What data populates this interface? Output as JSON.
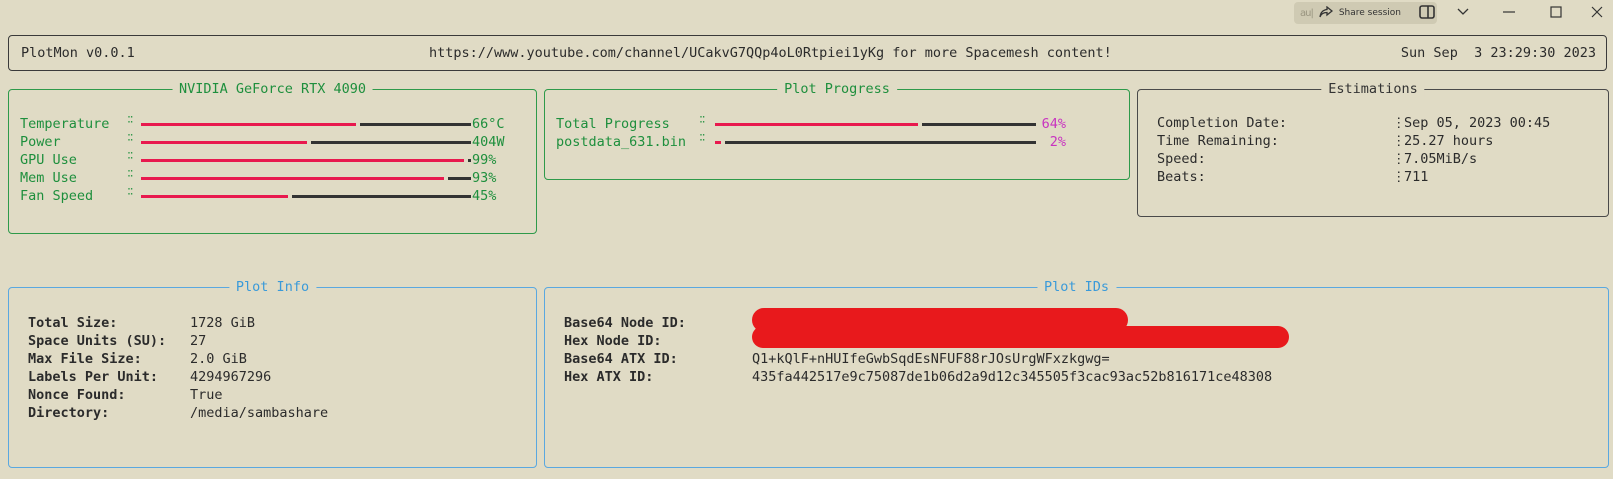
{
  "chrome": {
    "share_label": "Share session",
    "kbd_hint": "au|"
  },
  "header": {
    "app": "PlotMon v0.0.1",
    "message": "https://www.youtube.com/channel/UCakvG7QQp4oL0Rtpiei1yKg for more Spacemesh content!",
    "datetime": "Sun Sep  3 23:29:30 2023"
  },
  "gpu": {
    "title": "NVIDIA GeForce RTX 4090",
    "rows": [
      {
        "label": "Temperature",
        "value": "66°C",
        "level": 0.66
      },
      {
        "label": "Power",
        "value": "404W",
        "level": 0.51
      },
      {
        "label": "GPU Use",
        "value": "99%",
        "level": 0.99
      },
      {
        "label": "Mem Use",
        "value": "93%",
        "level": 0.93
      },
      {
        "label": "Fan Speed",
        "value": "45%",
        "level": 0.45
      }
    ]
  },
  "progress": {
    "title": "Plot Progress",
    "rows": [
      {
        "label": "Total Progress",
        "value": "64%",
        "level": 0.64
      },
      {
        "label": "postdata_631.bin",
        "value": "2%",
        "level": 0.02
      }
    ]
  },
  "estimations": {
    "title": "Estimations",
    "rows": [
      {
        "label": "Completion Date:",
        "value": "Sep 05, 2023 00:45"
      },
      {
        "label": "Time Remaining:",
        "value": "25.27 hours"
      },
      {
        "label": "Speed:",
        "value": "7.05MiB/s"
      },
      {
        "label": "Beats:",
        "value": "711"
      }
    ]
  },
  "plot_info": {
    "title": "Plot Info",
    "rows": [
      {
        "label": "Total Size:",
        "value": "1728 GiB"
      },
      {
        "label": "Space Units (SU):",
        "value": "27"
      },
      {
        "label": "Max File Size:",
        "value": "2.0 GiB"
      },
      {
        "label": "Labels Per Unit:",
        "value": "4294967296"
      },
      {
        "label": "Nonce Found:",
        "value": "True"
      },
      {
        "label": "Directory:",
        "value": "/media/sambashare"
      }
    ]
  },
  "plot_ids": {
    "title": "Plot IDs",
    "rows": [
      {
        "label": "Base64 Node ID:",
        "value": ""
      },
      {
        "label": "Hex Node ID:",
        "value": ""
      },
      {
        "label": "Base64 ATX ID:",
        "value": "Q1+kQlF+nHUIfeGwbSqdEsNFUF88rJOsUrgWFxzkgwg="
      },
      {
        "label": "Hex ATX ID:",
        "value": "435fa442517e9c75087de1b06d2a9d12c345505f3cac93ac52b816171ce48308"
      }
    ]
  },
  "colors": {
    "background": "#e0dbc5",
    "gauge_fill": "#e8194e",
    "gpu_text": "#1e8f3d",
    "progress_text": "#1e8f3d",
    "progress_value": "#c833c0",
    "info_title": "#3a9ad9",
    "redaction": "#e8191c"
  }
}
